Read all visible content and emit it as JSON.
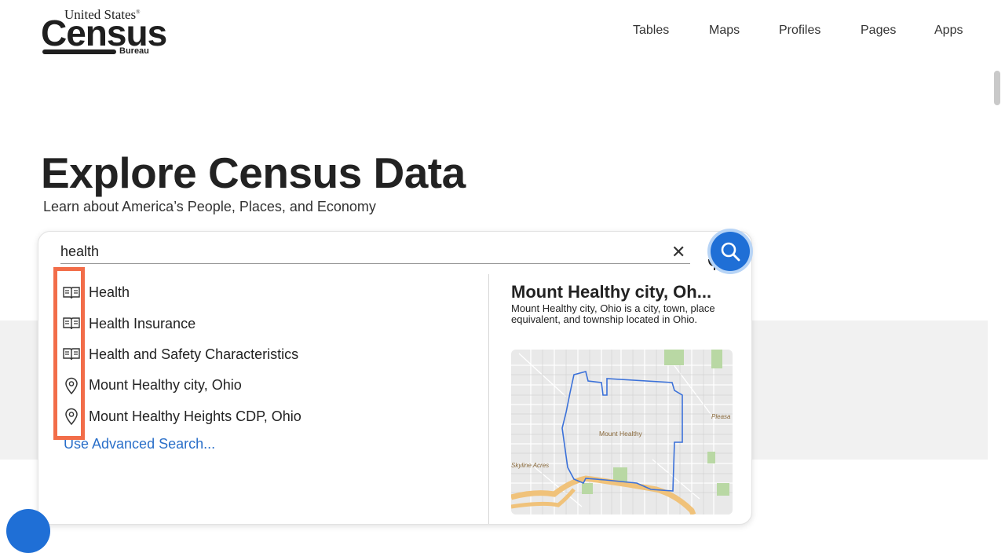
{
  "logo": {
    "top": "United States",
    "reg": "®",
    "main": "Census",
    "bottom": "Bureau"
  },
  "nav": [
    "Tables",
    "Maps",
    "Profiles",
    "Pages",
    "Apps"
  ],
  "hero": {
    "title": "Explore Census Data",
    "subtitle": "Learn about America’s People, Places, and Economy"
  },
  "search": {
    "value": "health",
    "clear_symbol": "✕"
  },
  "suggestions": [
    {
      "icon": "book-icon",
      "label": "Health"
    },
    {
      "icon": "book-icon",
      "label": "Health Insurance"
    },
    {
      "icon": "book-icon",
      "label": "Health and Safety Characteristics"
    },
    {
      "icon": "location-pin-icon",
      "label": "Mount Healthy city, Ohio"
    },
    {
      "icon": "location-pin-icon",
      "label": "Mount Healthy Heights CDP, Ohio"
    }
  ],
  "advanced_search": "Use Advanced Search...",
  "preview": {
    "title": "Mount Healthy city, Oh...",
    "description": "Mount Healthy city, Ohio is a city, town, place equivalent, and township located in Ohio.",
    "map_labels": {
      "city": "Mount Healthy",
      "west": "Skyline Acres",
      "east": "Pleasa"
    }
  },
  "colors": {
    "accent": "#1f6fd6",
    "link": "#2a6fc9",
    "highlight": "#f26d49"
  }
}
